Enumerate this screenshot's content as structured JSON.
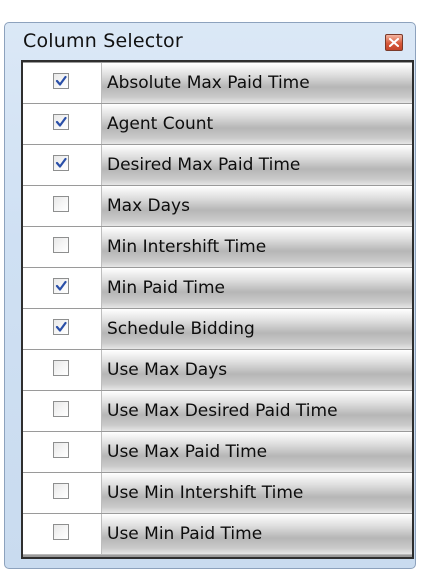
{
  "window": {
    "title": "Column Selector"
  },
  "columns": [
    {
      "label": "Absolute Max Paid Time",
      "checked": true
    },
    {
      "label": "Agent Count",
      "checked": true
    },
    {
      "label": "Desired Max Paid Time",
      "checked": true
    },
    {
      "label": "Max Days",
      "checked": false
    },
    {
      "label": "Min Intershift Time",
      "checked": false
    },
    {
      "label": "Min Paid Time",
      "checked": true
    },
    {
      "label": "Schedule Bidding",
      "checked": true
    },
    {
      "label": "Use Max Days",
      "checked": false
    },
    {
      "label": "Use Max Desired Paid Time",
      "checked": false
    },
    {
      "label": "Use Max Paid Time",
      "checked": false
    },
    {
      "label": "Use Min Intershift Time",
      "checked": false
    },
    {
      "label": "Use Min Paid Time",
      "checked": false
    }
  ],
  "colors": {
    "check_mark": "#2a4fa8",
    "close_button": "#d7593a"
  }
}
